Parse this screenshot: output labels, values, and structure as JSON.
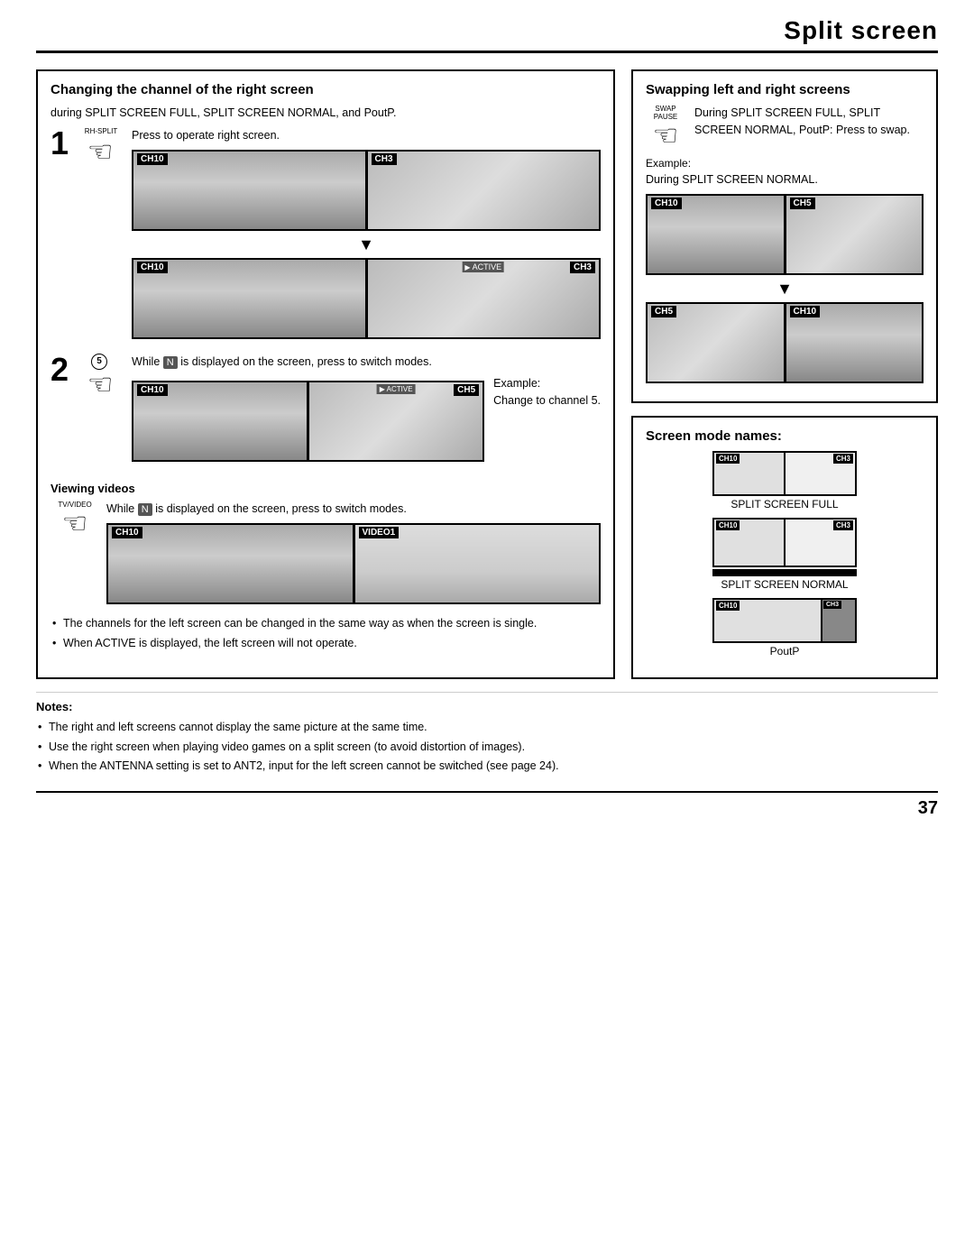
{
  "page": {
    "title": "Split screen",
    "number": "37"
  },
  "left_section": {
    "title": "Changing the channel of the right screen",
    "intro": "during SPLIT SCREEN FULL, SPLIT SCREEN NORMAL, and PoutP.",
    "step1": {
      "number": "1",
      "rh_label": "RH-SPLIT",
      "text": "Press to operate right screen.",
      "screen1": {
        "ch_left": "CH10",
        "ch_right": "CH3"
      },
      "screen2": {
        "ch_left": "CH10",
        "ch_active": "ACTIVE",
        "ch_right": "CH3"
      }
    },
    "step2": {
      "number": "2",
      "circle": "5",
      "text_before": "While",
      "icon_label": "N",
      "text_after": "is displayed on the screen, press to switch modes.",
      "screen3": {
        "ch_left": "CH10",
        "ch_active": "ACTIVE",
        "ch_right": "CH5"
      },
      "example_label": "Example:",
      "example_text": "Change to channel 5."
    },
    "viewing_videos": {
      "title": "Viewing videos",
      "tv_label": "TV/VIDEO",
      "text_before": "While",
      "icon_label": "N",
      "text_after": "is displayed on the screen, press to switch modes.",
      "screen": {
        "ch_left": "CH10",
        "ch_right": "VIDEO1"
      }
    },
    "bullets": [
      "The channels for the left screen can be changed in the same way as when the screen is single.",
      "When ACTIVE is displayed, the left screen will not operate."
    ]
  },
  "right_top_section": {
    "title": "Swapping left and right screens",
    "swap_btn_label": "SWAP PAUSE",
    "text": "During SPLIT SCREEN FULL, SPLIT SCREEN NORMAL, PoutP: Press to swap.",
    "example_label": "Example:",
    "example_text": "During SPLIT SCREEN NORMAL.",
    "screen_before": {
      "ch_left": "CH10",
      "ch_right": "CH5"
    },
    "screen_after": {
      "ch_left": "CH5",
      "ch_right": "CH10"
    }
  },
  "right_bottom_section": {
    "title": "Screen mode names:",
    "modes": [
      {
        "name": "SPLIT SCREEN FULL",
        "ch_left": "CH10",
        "ch_right": "CH3",
        "type": "full"
      },
      {
        "name": "SPLIT SCREEN NORMAL",
        "ch_left": "CH10",
        "ch_right": "CH3",
        "type": "normal"
      },
      {
        "name": "PoutP",
        "ch_left": "CH10",
        "ch_right": "CH3",
        "type": "poutp"
      }
    ]
  },
  "notes": {
    "title": "Notes:",
    "items": [
      "The right and left screens cannot display the same picture at the same time.",
      "Use  the right screen when playing video games on a split screen (to avoid distortion of images).",
      "When the ANTENNA setting is set to ANT2, input for the left screen cannot be switched (see page 24)."
    ]
  }
}
